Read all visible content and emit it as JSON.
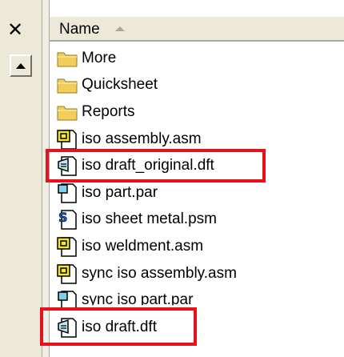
{
  "window": {
    "close_label": "✕"
  },
  "header": {
    "column_name": "Name",
    "sort_direction": "ascending"
  },
  "colors": {
    "highlight": "#e8101a",
    "folder": "#f3cd5b",
    "asm_icon": "#f5e52b"
  },
  "files": [
    {
      "name": "More",
      "icon": "folder-icon"
    },
    {
      "name": "Quicksheet",
      "icon": "folder-icon"
    },
    {
      "name": "Reports",
      "icon": "folder-icon"
    },
    {
      "name": "iso assembly.asm",
      "icon": "assembly-file-icon"
    },
    {
      "name": "iso draft_original.dft",
      "icon": "draft-file-icon"
    },
    {
      "name": "iso part.par",
      "icon": "part-file-icon"
    },
    {
      "name": "iso sheet metal.psm",
      "icon": "sheet-metal-file-icon"
    },
    {
      "name": "iso weldment.asm",
      "icon": "assembly-file-icon"
    },
    {
      "name": "sync iso assembly.asm",
      "icon": "assembly-file-icon"
    },
    {
      "name": "sync iso part.par",
      "icon": "part-file-icon"
    },
    {
      "name": "iso draft.dft",
      "icon": "draft-file-icon"
    }
  ]
}
